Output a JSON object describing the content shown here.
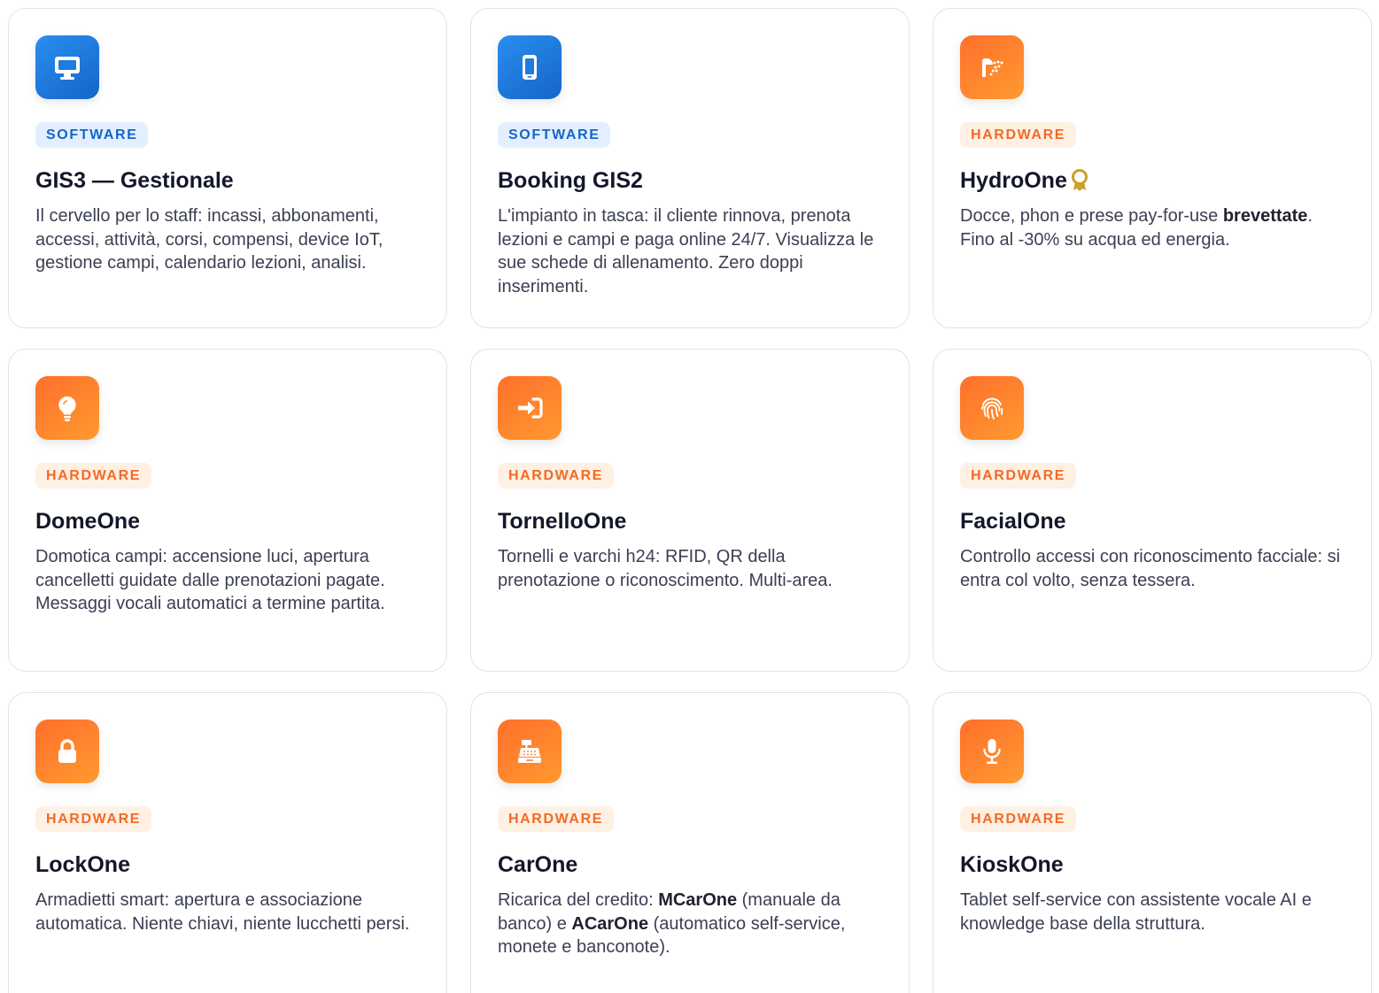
{
  "cards": [
    {
      "category": "SOFTWARE",
      "icon": "monitor-icon",
      "title": "GIS3 — Gestionale",
      "description": "Il cervello per lo staff: incassi, abbonamenti, accessi, attività, corsi, compensi, device IoT, gestione campi, calendario lezioni, analisi."
    },
    {
      "category": "SOFTWARE",
      "icon": "smartphone-icon",
      "title": "Booking GIS2",
      "description": "L'impianto in tasca: il cliente rinnova, prenota lezioni e campi e paga online 24/7. Visualizza le sue schede di allenamento. Zero doppi inserimenti."
    },
    {
      "category": "HARDWARE",
      "icon": "shower-icon",
      "title": "HydroOne",
      "title_icon": "award-icon",
      "description_pre": "Docce, phon e prese pay-for-use ",
      "description_bold": "brevettate",
      "description_post": ". Fino al -30% su acqua ed energia."
    },
    {
      "category": "HARDWARE",
      "icon": "lightbulb-icon",
      "title": "DomeOne",
      "description": "Domotica campi: accensione luci, apertura cancelletti guidate dalle prenotazioni pagate. Messaggi vocali automatici a termine partita."
    },
    {
      "category": "HARDWARE",
      "icon": "sign-in-icon",
      "title": "TornelloOne",
      "description": "Tornelli e varchi h24: RFID, QR della prenotazione o riconoscimento. Multi-area."
    },
    {
      "category": "HARDWARE",
      "icon": "fingerprint-icon",
      "title": "FacialOne",
      "description": "Controllo accessi con riconoscimento facciale: si entra col volto, senza tessera."
    },
    {
      "category": "HARDWARE",
      "icon": "lock-icon",
      "title": "LockOne",
      "description": "Armadietti smart: apertura e associazione automatica. Niente chiavi, niente lucchetti persi."
    },
    {
      "category": "HARDWARE",
      "icon": "cash-register-icon",
      "title": "CarOne",
      "description_pre": "Ricarica del credito: ",
      "description_bold1": "MCarOne",
      "description_mid": " (manuale da banco) e ",
      "description_bold2": "ACarOne",
      "description_post": " (automatico self-service, monete e banconote)."
    },
    {
      "category": "HARDWARE",
      "icon": "microphone-icon",
      "title": "KioskOne",
      "description": "Tablet self-service con assistente vocale AI e knowledge base della struttura."
    }
  ],
  "colors": {
    "software_accent": "#1565c8",
    "hardware_accent": "#f26a26",
    "award": "#c9a227"
  }
}
